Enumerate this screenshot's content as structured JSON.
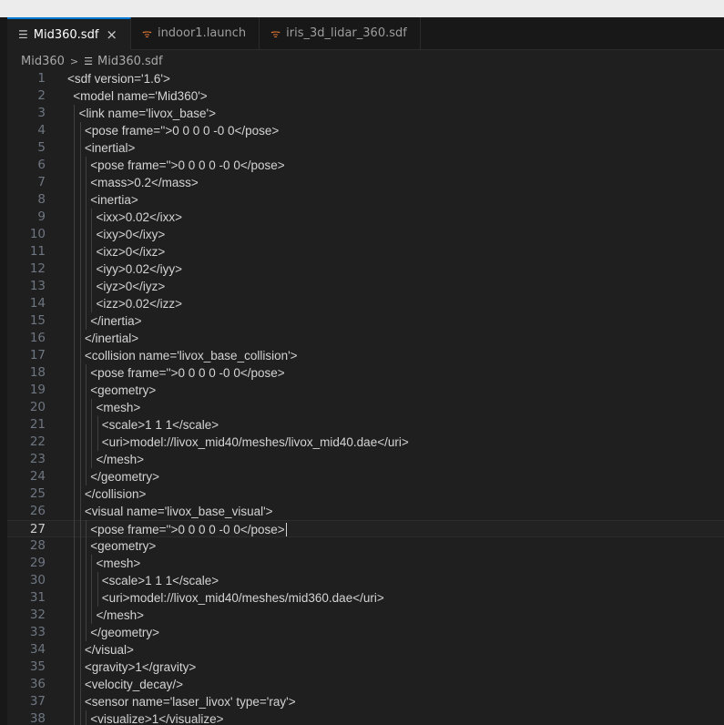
{
  "tabs": [
    {
      "label": "Mid360.sdf",
      "icon": "lines-icon",
      "active": true,
      "close": "×"
    },
    {
      "label": "indoor1.launch",
      "icon": "rss-icon",
      "active": false
    },
    {
      "label": "iris_3d_lidar_360.sdf",
      "icon": "rss-icon",
      "active": false
    }
  ],
  "breadcrumb": {
    "folder": "Mid360",
    "separator": ">",
    "file": "Mid360.sdf"
  },
  "editor": {
    "current_line": 27,
    "lines": [
      {
        "n": "1",
        "indent": 0,
        "text": "<sdf version='1.6'>"
      },
      {
        "n": "2",
        "indent": 1,
        "text": "<model name='Mid360'>"
      },
      {
        "n": "3",
        "indent": 2,
        "text": "<link name='livox_base'>"
      },
      {
        "n": "4",
        "indent": 3,
        "text": "<pose frame=''>0 0 0 0 -0 0</pose>"
      },
      {
        "n": "5",
        "indent": 3,
        "text": "<inertial>"
      },
      {
        "n": "6",
        "indent": 4,
        "text": "<pose frame=''>0 0 0 0 -0 0</pose>"
      },
      {
        "n": "7",
        "indent": 4,
        "text": "<mass>0.2</mass>"
      },
      {
        "n": "8",
        "indent": 4,
        "text": "<inertia>"
      },
      {
        "n": "9",
        "indent": 5,
        "text": "<ixx>0.02</ixx>"
      },
      {
        "n": "10",
        "indent": 5,
        "text": "<ixy>0</ixy>"
      },
      {
        "n": "11",
        "indent": 5,
        "text": "<ixz>0</ixz>"
      },
      {
        "n": "12",
        "indent": 5,
        "text": "<iyy>0.02</iyy>"
      },
      {
        "n": "13",
        "indent": 5,
        "text": "<iyz>0</iyz>"
      },
      {
        "n": "14",
        "indent": 5,
        "text": "<izz>0.02</izz>"
      },
      {
        "n": "15",
        "indent": 4,
        "text": "</inertia>"
      },
      {
        "n": "16",
        "indent": 3,
        "text": "</inertial>"
      },
      {
        "n": "17",
        "indent": 3,
        "text": "<collision name='livox_base_collision'>"
      },
      {
        "n": "18",
        "indent": 4,
        "text": "<pose frame=''>0 0 0 0 -0 0</pose>"
      },
      {
        "n": "19",
        "indent": 4,
        "text": "<geometry>"
      },
      {
        "n": "20",
        "indent": 5,
        "text": "<mesh>"
      },
      {
        "n": "21",
        "indent": 6,
        "text": "<scale>1 1 1</scale>"
      },
      {
        "n": "22",
        "indent": 6,
        "text": "<uri>model://livox_mid40/meshes/livox_mid40.dae</uri>"
      },
      {
        "n": "23",
        "indent": 5,
        "text": "</mesh>"
      },
      {
        "n": "24",
        "indent": 4,
        "text": "</geometry>"
      },
      {
        "n": "25",
        "indent": 3,
        "text": "</collision>"
      },
      {
        "n": "26",
        "indent": 3,
        "text": "<visual name='livox_base_visual'>"
      },
      {
        "n": "27",
        "indent": 4,
        "text": "<pose frame=''>0 0 0 0 -0 0</pose>"
      },
      {
        "n": "28",
        "indent": 4,
        "text": "<geometry>"
      },
      {
        "n": "29",
        "indent": 5,
        "text": "<mesh>"
      },
      {
        "n": "30",
        "indent": 6,
        "text": "<scale>1 1 1</scale>"
      },
      {
        "n": "31",
        "indent": 6,
        "text": "<uri>model://livox_mid40/meshes/mid360.dae</uri>"
      },
      {
        "n": "32",
        "indent": 5,
        "text": "</mesh>"
      },
      {
        "n": "33",
        "indent": 4,
        "text": "</geometry>"
      },
      {
        "n": "34",
        "indent": 3,
        "text": "</visual>"
      },
      {
        "n": "35",
        "indent": 3,
        "text": "<gravity>1</gravity>"
      },
      {
        "n": "36",
        "indent": 3,
        "text": "<velocity_decay/>"
      },
      {
        "n": "37",
        "indent": 3,
        "text": "<sensor name='laser_livox' type='ray'>"
      },
      {
        "n": "38",
        "indent": 4,
        "text": "<visualize>1</visualize>"
      }
    ]
  }
}
